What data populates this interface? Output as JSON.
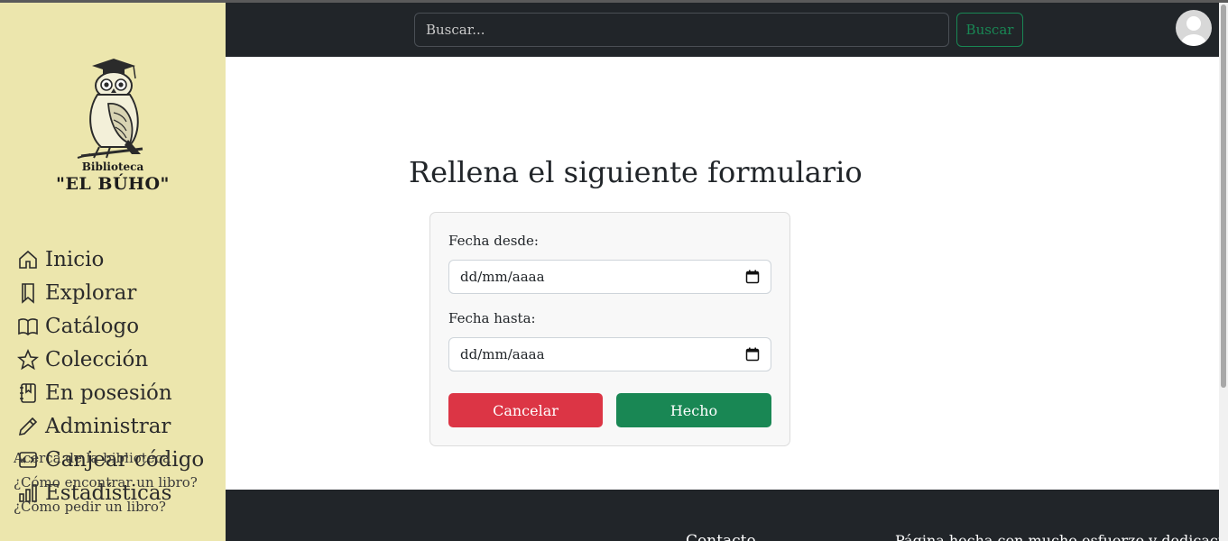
{
  "logo": {
    "line1": "Biblioteca",
    "line2": "\"EL BÚHO\""
  },
  "sidebar": {
    "items": [
      {
        "label": "Inicio",
        "icon": "house-icon"
      },
      {
        "label": "Explorar",
        "icon": "bookmark-icon"
      },
      {
        "label": "Catálogo",
        "icon": "book-open-icon"
      },
      {
        "label": "Colección",
        "icon": "star-icon"
      },
      {
        "label": "En posesión",
        "icon": "journal-bookmark-icon"
      },
      {
        "label": "Administrar",
        "icon": "pencil-icon"
      },
      {
        "label": "Canjear código",
        "icon": "code-icon"
      },
      {
        "label": "Estadísticas",
        "icon": "bar-chart-icon"
      }
    ],
    "help_links": [
      "Acerca de la biblioteca",
      "¿Cómo encontrar un libro?",
      "¿Cómo pedir un libro?"
    ]
  },
  "header": {
    "search_placeholder": "Buscar...",
    "search_button": "Buscar"
  },
  "main": {
    "title": "Rellena el siguiente formulario",
    "form": {
      "from_label": "Fecha desde:",
      "from_value": "dd/mm/aaaa",
      "to_label": "Fecha hasta:",
      "to_value": "dd/mm/aaaa",
      "cancel": "Cancelar",
      "done": "Hecho"
    }
  },
  "footer": {
    "contact": "Contacto",
    "made": "Página hecha con mucho esfuerzo y dedicación"
  },
  "colors": {
    "sidebar_bg": "#ece6ad",
    "header_bg": "#212529",
    "success": "#198754",
    "danger": "#dc3545"
  }
}
